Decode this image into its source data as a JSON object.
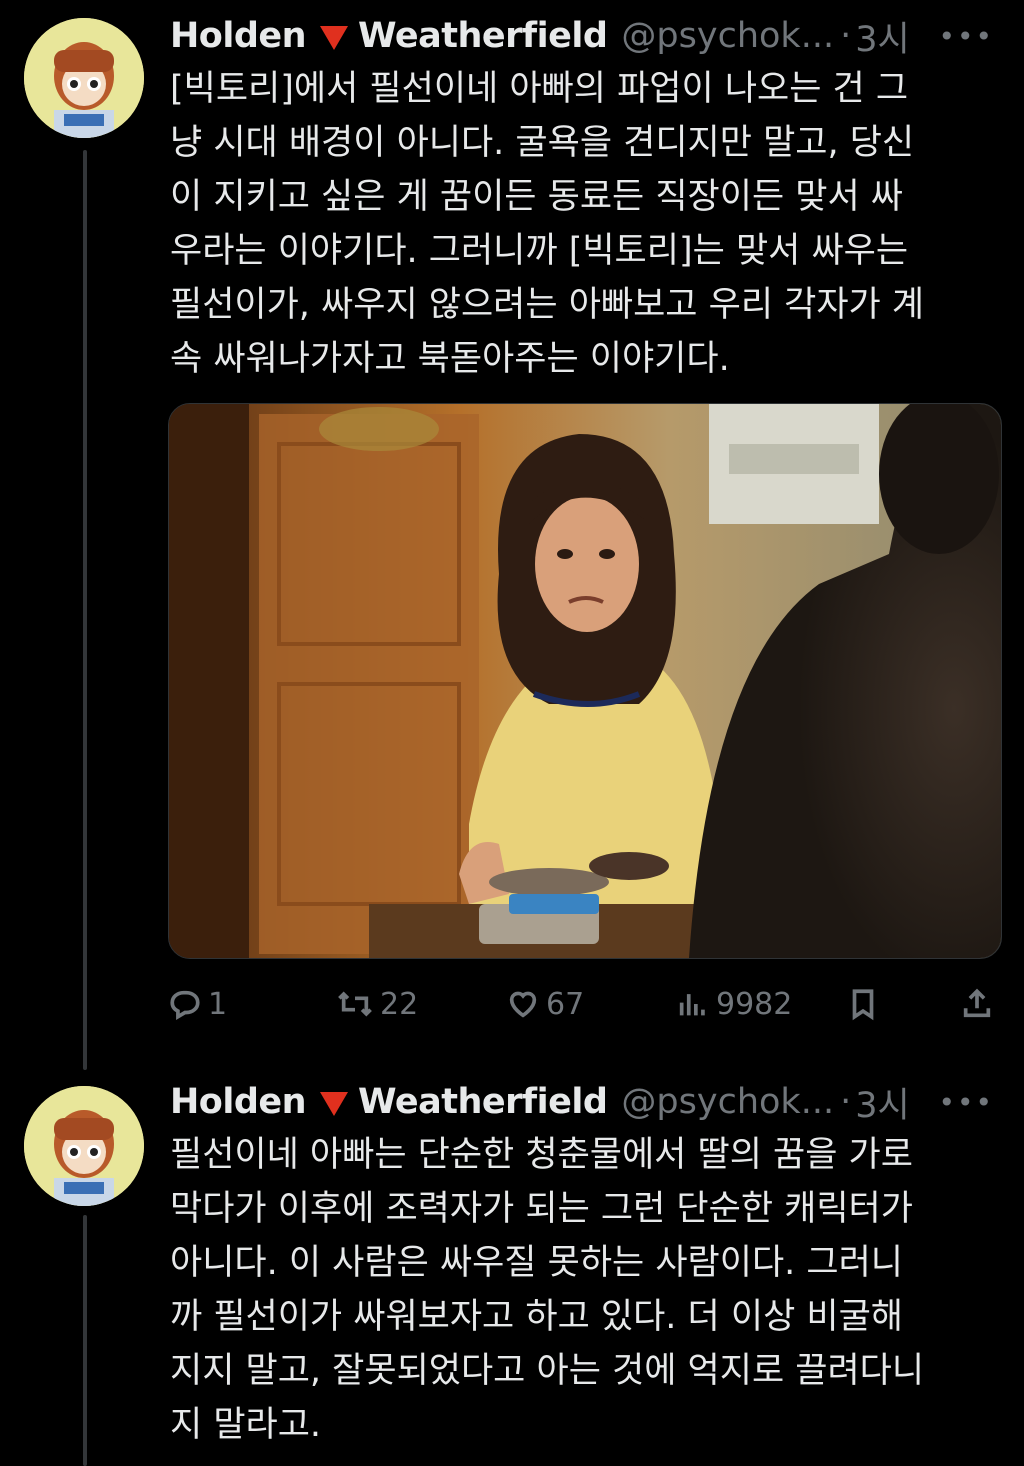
{
  "colors": {
    "background": "#000000",
    "text": "#e7e9ea",
    "secondary": "#71767b",
    "flag": "#e0301e"
  },
  "tweets": [
    {
      "author_name": "Holden",
      "author_name_2": "Weatherfield",
      "flag_icon": "red-triangle-down-icon",
      "handle": "@psychok...",
      "separator": "·",
      "time": "3시",
      "more_icon": "more-dots-icon",
      "lines": [
        "[빅토리]에서 필선이네 아빠의 파업이 나오는 건 그",
        "냥 시대 배경이 아니다. 굴욕을 견디지만 말고, 당신",
        "이 지키고 싶은 게 꿈이든 동료든 직장이든 맞서 싸",
        "우라는 이야기다. 그러니까 [빅토리]는 맞서 싸우는",
        "필선이가, 싸우지 않으려는 아빠보고 우리 각자가 계",
        "속 싸워나가자고 북돋아주는 이야기다."
      ],
      "actions": {
        "reply_count": "1",
        "retweet_count": "22",
        "like_count": "67",
        "view_count": "9982"
      }
    },
    {
      "author_name": "Holden",
      "author_name_2": "Weatherfield",
      "flag_icon": "red-triangle-down-icon",
      "handle": "@psychok...",
      "separator": "·",
      "time": "3시",
      "more_icon": "more-dots-icon",
      "lines": [
        "필선이네 아빠는 단순한 청춘물에서 딸의 꿈을 가로",
        "막다가 이후에 조력자가 되는 그런 단순한 캐릭터가",
        "아니다. 이 사람은 싸우질 못하는 사람이다. 그러니",
        "까 필선이가 싸워보자고 하고 있다. 더 이상 비굴해",
        "지지 말고, 잘못되었다고 아는 것에 억지로 끌려다니",
        "지 말라고."
      ]
    }
  ]
}
